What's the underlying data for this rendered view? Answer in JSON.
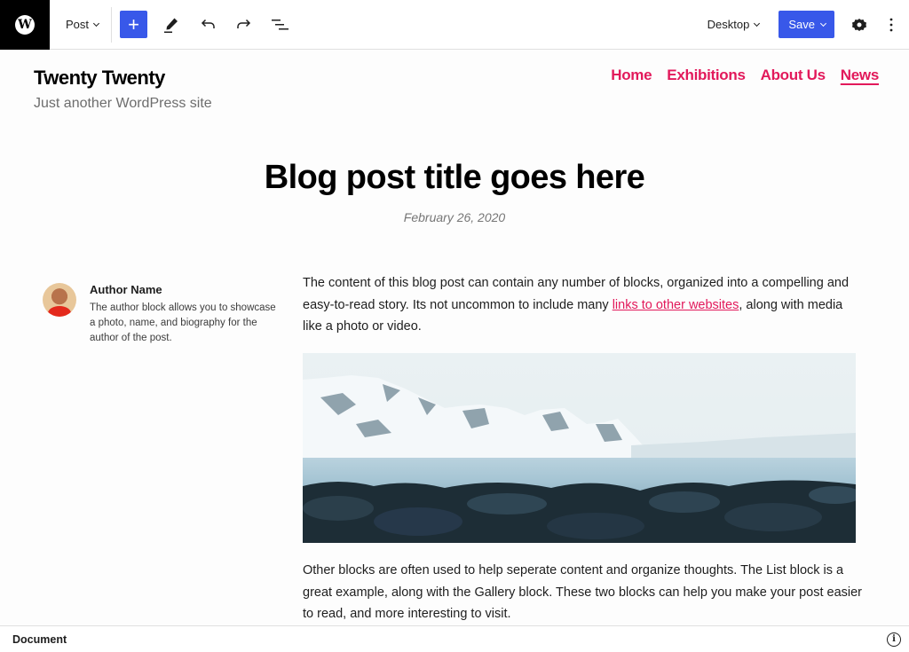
{
  "toolbar": {
    "logo_icon": "wordpress-logo-icon",
    "post_type_label": "Post",
    "add_block_icon": "plus-icon",
    "add_block_symbol": "+",
    "tools": [
      "pen-icon",
      "undo-icon",
      "redo-icon",
      "list-view-icon"
    ],
    "device_label": "Desktop",
    "save_label": "Save",
    "settings_icon": "gear-icon",
    "options_icon": "kebab-icon",
    "accent_color": "#3858e9"
  },
  "site": {
    "title": "Twenty Twenty",
    "description": "Just another WordPress site",
    "nav": [
      {
        "label": "Home",
        "current": false
      },
      {
        "label": "Exhibitions",
        "current": false
      },
      {
        "label": "About Us",
        "current": false
      },
      {
        "label": "News",
        "current": true
      }
    ],
    "link_color": "#e2195b"
  },
  "post": {
    "title": "Blog post title goes here",
    "date": "February 26, 2020",
    "author": {
      "name": "Author Name",
      "bio": "The author block allows you to showcase a photo, name, and biography for the author of the post."
    },
    "paragraph1": {
      "before_link": "The content of this blog post can contain any number of blocks, organized into a compelling and easy-to-read story. Its not uncommon to include many ",
      "link_text": "links to other websites",
      "after_link": ", along with media like a photo or video."
    },
    "image_alt": "snowy mountains over a lake with rocks",
    "paragraph2": "Other blocks are often used to help seperate content and organize thoughts. The List block is a great example, along with the Gallery block. These two blocks can help you make your post easier to read, and more interesting to visit."
  },
  "statusbar": {
    "label": "Document",
    "info_icon": "info-icon",
    "info_symbol": "i"
  }
}
